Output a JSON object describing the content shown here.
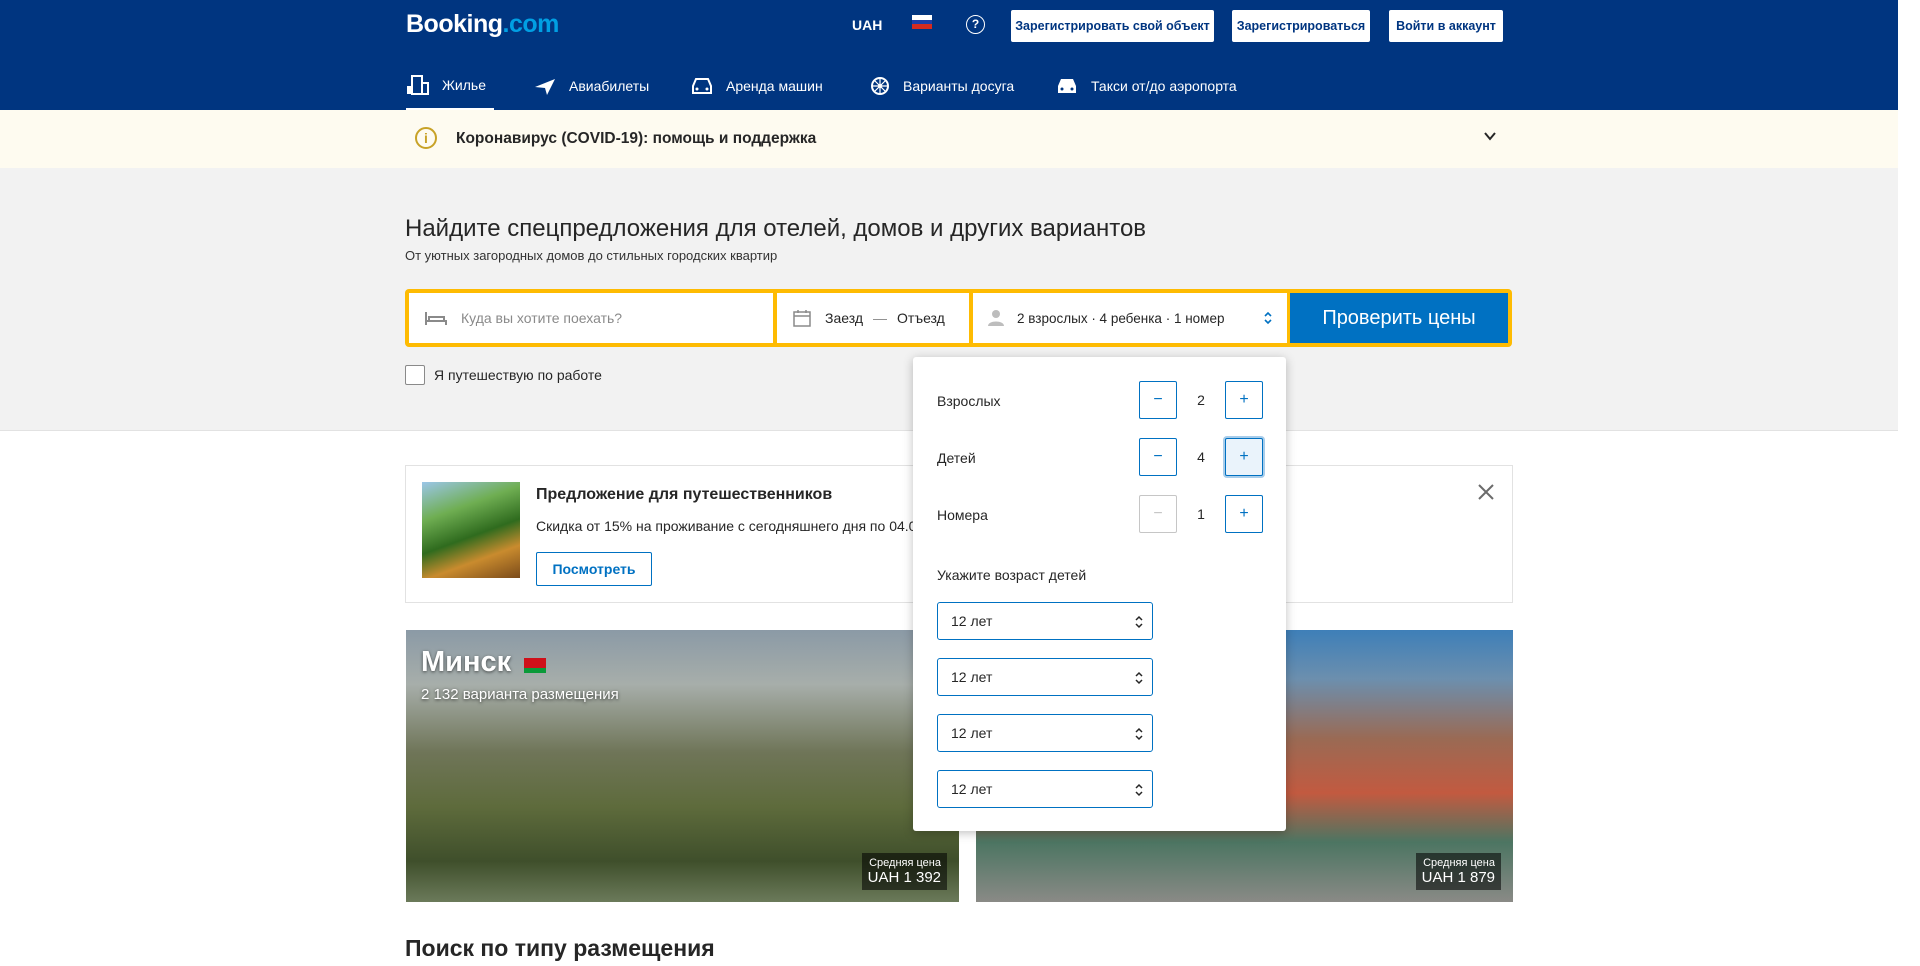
{
  "header": {
    "logo_main": "Booking",
    "logo_dot": ".com",
    "currency": "UAH",
    "help_glyph": "?",
    "list_property_label": "Зарегистрировать свой объект",
    "register_label": "Зарегистрироваться",
    "signin_label": "Войти в аккаунт",
    "nav": [
      {
        "label": "Жилье",
        "icon": "bed-icon",
        "active": true
      },
      {
        "label": "Авиабилеты",
        "icon": "plane-icon"
      },
      {
        "label": "Аренда машин",
        "icon": "car-icon"
      },
      {
        "label": "Варианты досуга",
        "icon": "attractions-icon"
      },
      {
        "label": "Такси от/до аэропорта",
        "icon": "taxi-icon"
      }
    ]
  },
  "covid": {
    "text": "Коронавирус (COVID-19): помощь и поддержка",
    "icon_glyph": "i"
  },
  "hero": {
    "title": "Найдите спецпредложения для отелей, домов и других вариантов",
    "subtitle": "От уютных загородных домов до стильных городских квартир",
    "destination_placeholder": "Куда вы хотите поехать?",
    "checkin_label": "Заезд",
    "date_separator": "—",
    "checkout_label": "Отъезд",
    "guests_summary": "2 взрослых · 4 ребенка · 1 номер",
    "search_button": "Проверить цены",
    "work_trip_label": "Я путешествую по работе"
  },
  "offer": {
    "title": "Предложение для путешественников",
    "description": "Скидка от 15% на проживание с сегодняшнего дня по 04.0",
    "button": "Посмотреть"
  },
  "destinations": [
    {
      "name": "Минск",
      "count": "2 132 варианта размещения",
      "price_label": "Средняя цена",
      "price": "UAH 1 392"
    },
    {
      "price_label": "Средняя цена",
      "price": "UAH 1 879"
    }
  ],
  "section_title": "Поиск по типу размещения",
  "guests_popup": {
    "adults": {
      "label": "Взрослых",
      "value": "2"
    },
    "children": {
      "label": "Детей",
      "value": "4"
    },
    "rooms": {
      "label": "Номера",
      "value": "1"
    },
    "minus_glyph": "−",
    "plus_glyph": "+",
    "ages_label": "Укажите возраст детей",
    "ages": [
      "12 лет",
      "12 лет",
      "12 лет",
      "12 лет"
    ]
  },
  "colors": {
    "brand_blue": "#003580",
    "action_blue": "#0071c2",
    "search_border": "#febb02"
  }
}
